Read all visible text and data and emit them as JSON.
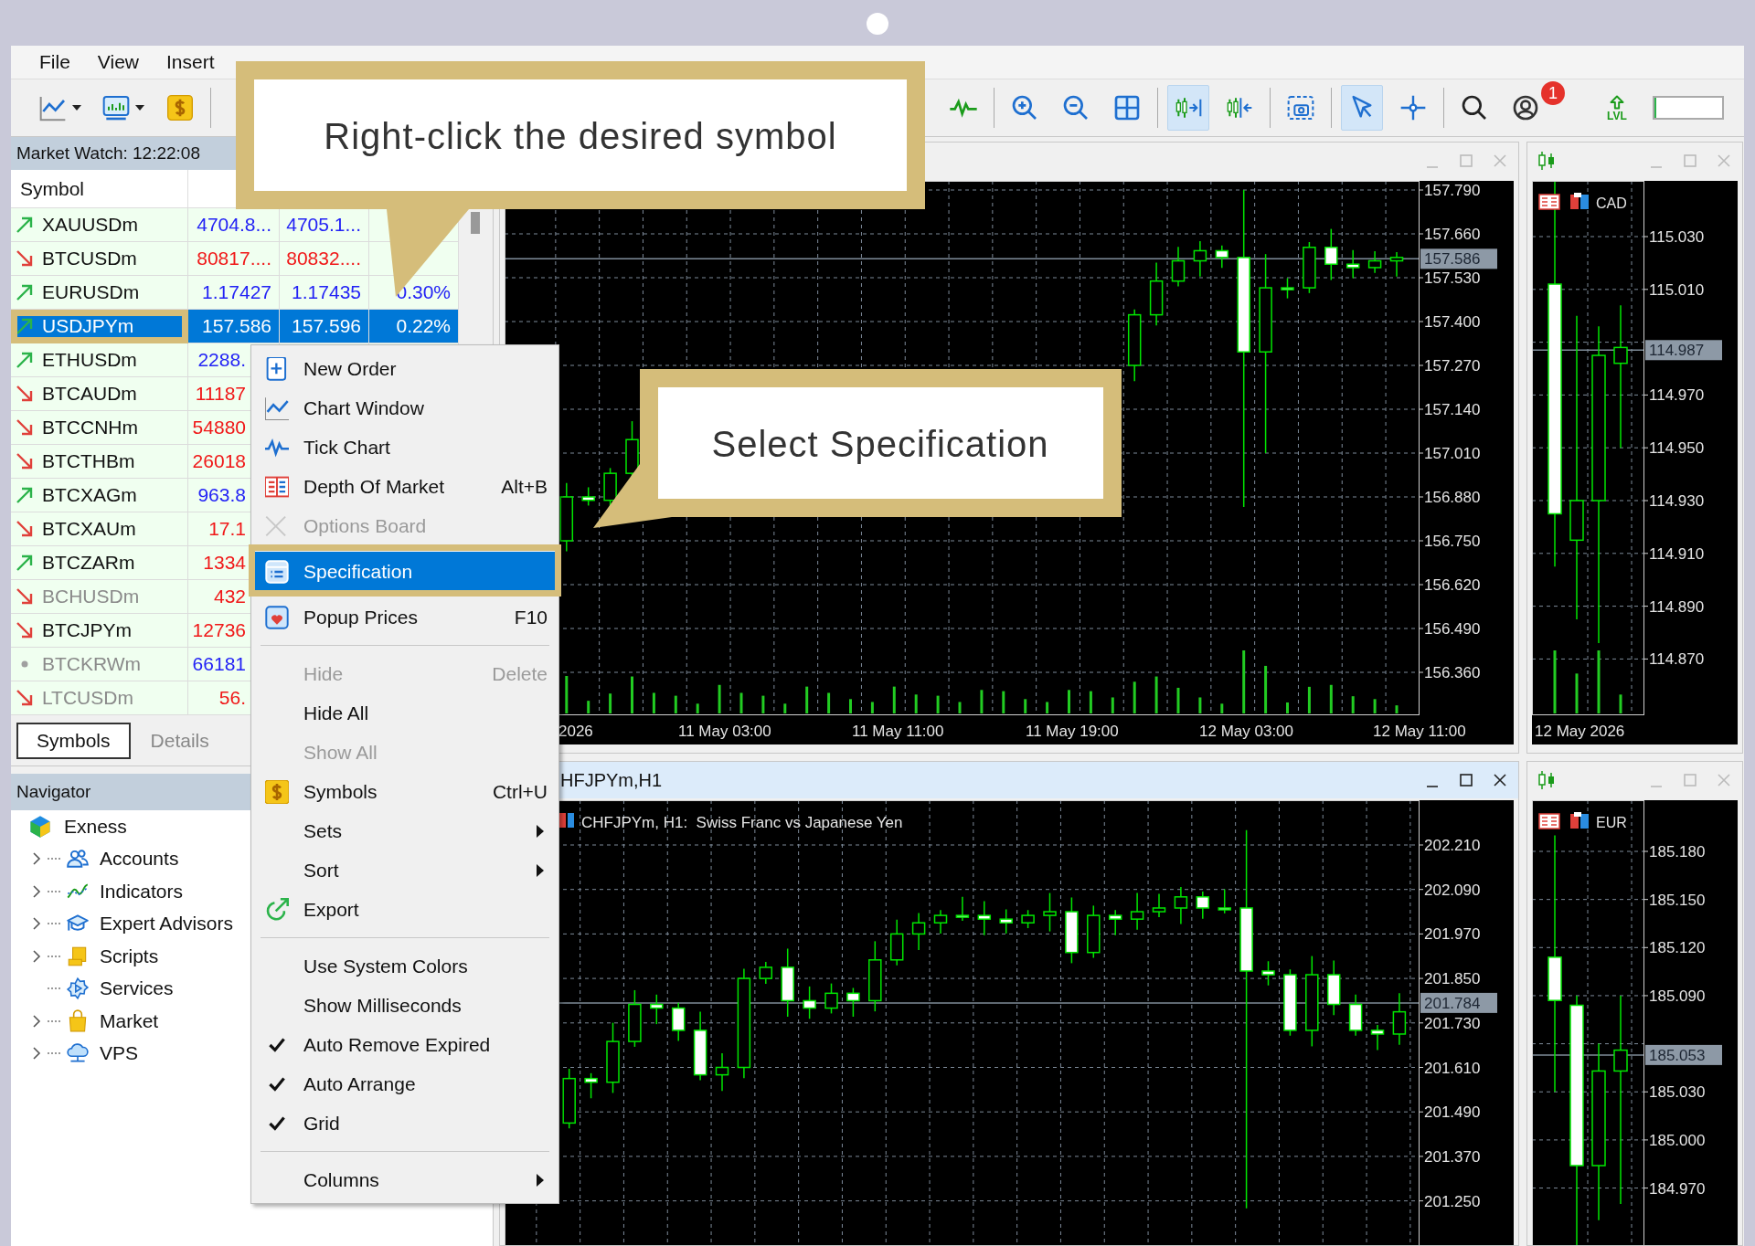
{
  "menu_bar": [
    {
      "label": "File"
    },
    {
      "label": "View"
    },
    {
      "label": "Insert"
    }
  ],
  "toolbar": {
    "buttons": [
      {
        "pressed": false
      },
      {
        "pressed": false
      },
      {
        "pressed": false
      },
      {
        "pressed": false
      },
      {
        "pressed": false
      },
      {
        "pressed": false
      },
      {
        "pressed": false
      },
      {
        "pressed": true
      },
      {
        "pressed": false
      },
      {
        "pressed": false
      },
      {
        "pressed": true
      },
      {
        "pressed": false
      },
      {
        "pressed": false
      },
      {
        "pressed": false
      }
    ],
    "badge": "1",
    "level_button_label": "LVL",
    "level_meter": {
      "level": 0.03
    }
  },
  "market_watch": {
    "title": "Market Watch: 12:22:08",
    "columns": [
      "Symbol"
    ],
    "rows": [
      {
        "symbol": "XAUUSDm",
        "kind": "up",
        "bid": "4704.8...",
        "ask": "4705.1...",
        "color": "#2323f5",
        "dimmed": false,
        "selected": false
      },
      {
        "symbol": "BTCUSDm",
        "kind": "down",
        "bid": "80817....",
        "ask": "80832....",
        "color": "#f01818",
        "dimmed": false,
        "selected": false
      },
      {
        "symbol": "EURUSDm",
        "kind": "up",
        "bid": "1.17427",
        "ask": "1.17435",
        "change": "0.30%",
        "color": "#2323f5",
        "dimmed": false,
        "selected": false
      },
      {
        "symbol": "USDJPYm",
        "kind": "up",
        "bid": "157.586",
        "ask": "157.596",
        "change": "0.22%",
        "dimmed": false,
        "selected": true
      },
      {
        "symbol": "ETHUSDm",
        "kind": "up",
        "bid": "2288.",
        "color": "#2323f5",
        "dimmed": false,
        "selected": false
      },
      {
        "symbol": "BTCAUDm",
        "kind": "down",
        "bid": "11187",
        "color": "#f01818",
        "dimmed": false,
        "selected": false
      },
      {
        "symbol": "BTCCNHm",
        "kind": "down",
        "bid": "54880",
        "color": "#f01818",
        "dimmed": false,
        "selected": false
      },
      {
        "symbol": "BTCTHBm",
        "kind": "down",
        "bid": "26018",
        "color": "#f01818",
        "dimmed": false,
        "selected": false
      },
      {
        "symbol": "BTCXAGm",
        "kind": "up",
        "bid": "963.8",
        "color": "#2323f5",
        "dimmed": false,
        "selected": false
      },
      {
        "symbol": "BTCXAUm",
        "kind": "down",
        "bid": "17.1",
        "color": "#f01818",
        "dimmed": false,
        "selected": false
      },
      {
        "symbol": "BTCZARm",
        "kind": "up",
        "bid": "1334",
        "color": "#f01818",
        "dimmed": false,
        "selected": false
      },
      {
        "symbol": "BCHUSDm",
        "kind": "down",
        "bid": "432",
        "color": "#f01818",
        "dimmed": true,
        "selected": false
      },
      {
        "symbol": "BTCJPYm",
        "kind": "down",
        "bid": "12736",
        "color": "#f01818",
        "dimmed": false,
        "selected": false
      },
      {
        "symbol": "BTCKRWm",
        "kind": "flat",
        "bid": "66181",
        "color": "#2323f5",
        "dimmed": true,
        "selected": false
      },
      {
        "symbol": "LTCUSDm",
        "kind": "down",
        "bid": "56.",
        "color": "#f01818",
        "dimmed": true,
        "selected": false
      }
    ],
    "tabs": [
      {
        "label": "Symbols",
        "selected": true
      },
      {
        "label": "Details",
        "selected": false
      }
    ]
  },
  "navigator": {
    "title": "Navigator",
    "root": {
      "label": "Exness",
      "children": [
        {
          "label": "Accounts",
          "expandable": true
        },
        {
          "label": "Indicators",
          "expandable": true
        },
        {
          "label": "Expert Advisors",
          "expandable": true
        },
        {
          "label": "Scripts",
          "expandable": true
        },
        {
          "label": "Services",
          "expandable": false
        },
        {
          "label": "Market",
          "expandable": true
        },
        {
          "label": "VPS",
          "expandable": true
        }
      ]
    }
  },
  "charts": [
    {
      "active": false,
      "price_labels": [
        "157.790",
        "157.660",
        "157.530",
        "157.400",
        "157.270",
        "157.140",
        "157.010",
        "156.880",
        "156.750",
        "156.620",
        "156.490",
        "156.360"
      ],
      "current_price": "157.586",
      "time_labels": [
        "2026",
        "11 May 03:00",
        "11 May 11:00",
        "11 May 19:00",
        "12 May 03:00",
        "12 May 11:00"
      ]
    },
    {
      "active": false,
      "currency": "CAD",
      "price_labels": [
        "115.030",
        "115.010",
        "114.970",
        "114.950",
        "114.930",
        "114.910",
        "114.890",
        "114.870"
      ],
      "current_price": "114.987",
      "time_labels": [
        "12 May 2026"
      ]
    },
    {
      "active": true,
      "title": "HFJPYm,H1",
      "caption": "CHFJPYm, H1:  Swiss Franc vs Japanese Yen",
      "price_labels": [
        "202.210",
        "202.090",
        "201.970",
        "201.850",
        "201.730",
        "201.610",
        "201.490",
        "201.370",
        "201.250"
      ],
      "current_price": "201.784"
    },
    {
      "active": false,
      "currency": "EUR",
      "price_labels": [
        "185.180",
        "185.150",
        "185.120",
        "185.090",
        "185.030",
        "185.000",
        "184.970"
      ],
      "current_price": "185.053"
    }
  ],
  "context_menu": {
    "items": [
      {
        "kind": "item",
        "label": "New Order",
        "disabled": false,
        "selected": false,
        "checked": false,
        "submenu": false
      },
      {
        "kind": "item",
        "label": "Chart Window",
        "disabled": false,
        "selected": false,
        "checked": false,
        "submenu": false
      },
      {
        "kind": "item",
        "label": "Tick Chart",
        "disabled": false,
        "selected": false,
        "checked": false,
        "submenu": false
      },
      {
        "kind": "item",
        "label": "Depth Of Market",
        "shortcut": "Alt+B",
        "disabled": false,
        "selected": false,
        "checked": false,
        "submenu": false
      },
      {
        "kind": "item",
        "label": "Options Board",
        "disabled": true,
        "selected": false,
        "checked": false,
        "submenu": false
      },
      {
        "kind": "item",
        "label": "Specification",
        "disabled": false,
        "selected": true,
        "checked": false,
        "submenu": false
      },
      {
        "kind": "item",
        "label": "Popup Prices",
        "shortcut": "F10",
        "disabled": false,
        "selected": false,
        "checked": false,
        "submenu": false
      },
      {
        "kind": "separator"
      },
      {
        "kind": "item",
        "label": "Hide",
        "shortcut": "Delete",
        "disabled": true,
        "selected": false,
        "checked": false,
        "submenu": false
      },
      {
        "kind": "item",
        "label": "Hide All",
        "disabled": false,
        "selected": false,
        "checked": false,
        "submenu": false
      },
      {
        "kind": "item",
        "label": "Show All",
        "disabled": true,
        "selected": false,
        "checked": false,
        "submenu": false
      },
      {
        "kind": "item",
        "label": "Symbols",
        "shortcut": "Ctrl+U",
        "disabled": false,
        "selected": false,
        "checked": false,
        "submenu": false
      },
      {
        "kind": "item",
        "label": "Sets",
        "disabled": false,
        "selected": false,
        "checked": false,
        "submenu": true
      },
      {
        "kind": "item",
        "label": "Sort",
        "disabled": false,
        "selected": false,
        "checked": false,
        "submenu": true
      },
      {
        "kind": "item",
        "label": "Export",
        "disabled": false,
        "selected": false,
        "checked": false,
        "submenu": false
      },
      {
        "kind": "separator"
      },
      {
        "kind": "item",
        "label": "Use System Colors",
        "disabled": false,
        "selected": false,
        "checked": false,
        "submenu": false
      },
      {
        "kind": "item",
        "label": "Show Milliseconds",
        "disabled": false,
        "selected": false,
        "checked": false,
        "submenu": false
      },
      {
        "kind": "item",
        "label": "Auto Remove Expired",
        "disabled": false,
        "selected": false,
        "checked": true,
        "submenu": false
      },
      {
        "kind": "item",
        "label": "Auto Arrange",
        "disabled": false,
        "selected": false,
        "checked": true,
        "submenu": false
      },
      {
        "kind": "item",
        "label": "Grid",
        "disabled": false,
        "selected": false,
        "checked": true,
        "submenu": false
      },
      {
        "kind": "separator"
      },
      {
        "kind": "item",
        "label": "Columns",
        "disabled": false,
        "selected": false,
        "checked": false,
        "submenu": true
      }
    ]
  },
  "callouts": [
    {
      "text": "Right-click the desired symbol"
    },
    {
      "text": "Select Specification"
    }
  ]
}
